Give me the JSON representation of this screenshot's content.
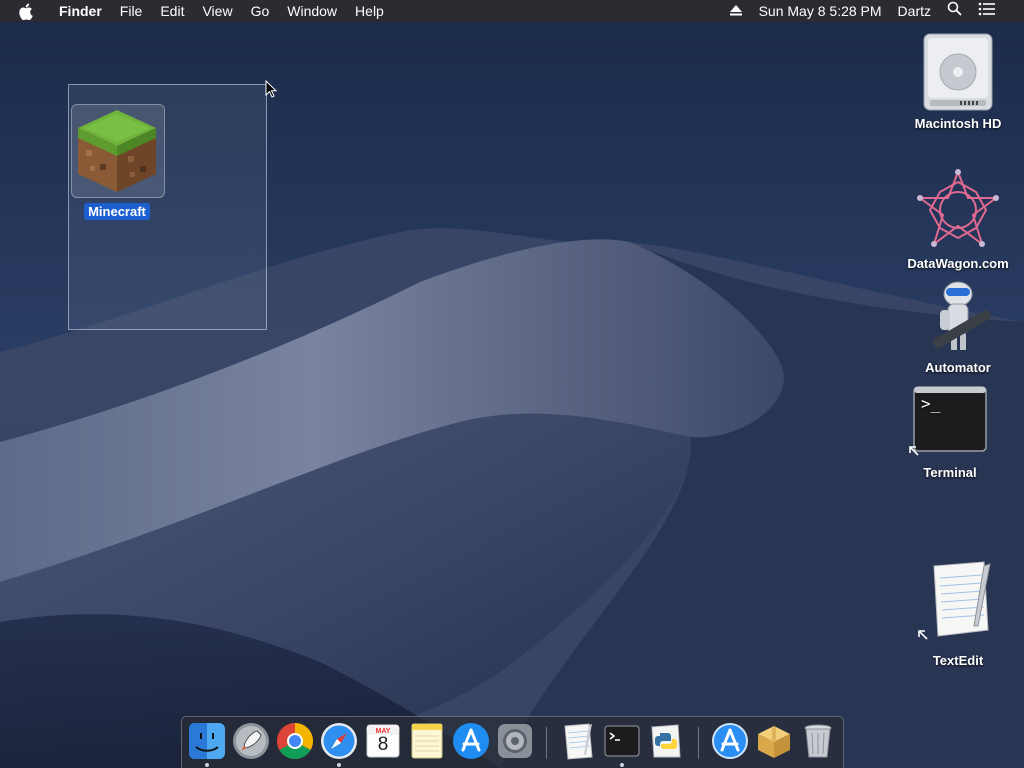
{
  "menubar": {
    "app_name": "Finder",
    "menus": [
      "File",
      "Edit",
      "View",
      "Go",
      "Window",
      "Help"
    ],
    "datetime": "Sun May 8  5:28 PM",
    "user": "Dartz"
  },
  "desktop_icons": {
    "minecraft": "Minecraft",
    "macintosh_hd": "Macintosh HD",
    "datawagon": "DataWagon.com",
    "automator": "Automator",
    "terminal": "Terminal",
    "textedit": "TextEdit"
  },
  "dock": {
    "calendar_month": "MAY",
    "calendar_day": "8",
    "terminal_prompt": ">_"
  },
  "colors": {
    "selection_label": "#1d5fd1",
    "menubar": "#2a2c31"
  }
}
